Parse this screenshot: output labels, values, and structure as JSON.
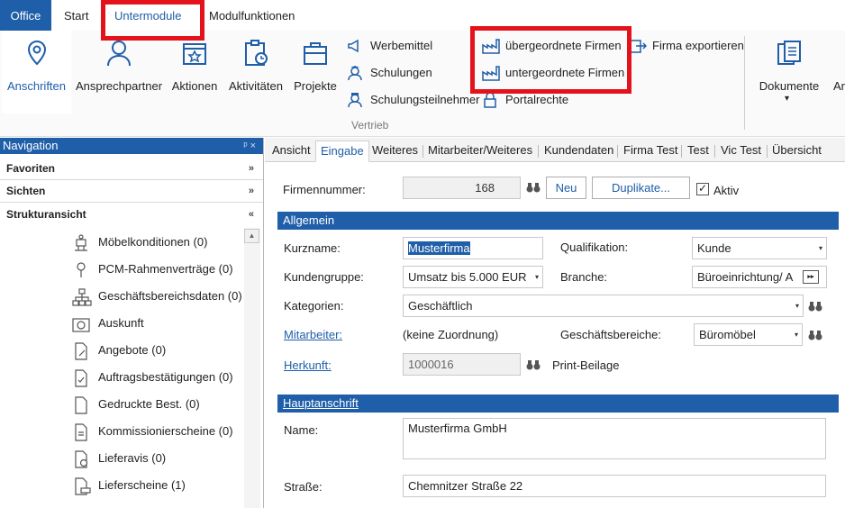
{
  "ribbon_tabs": [
    "Office",
    "Start",
    "Untermodule",
    "Modulfunktionen"
  ],
  "ribbon": {
    "big_buttons": [
      "Anschriften",
      "Ansprechpartner",
      "Aktionen",
      "Aktivitäten",
      "Projekte"
    ],
    "vertrieb_items": [
      "Werbemittel",
      "Schulungen",
      "Schulungsteilnehmer"
    ],
    "firm_items": [
      "übergeordnete Firmen",
      "untergeordnete Firmen"
    ],
    "portalrechte": "Portalrechte",
    "firma_exportieren": "Firma exportieren",
    "group_name": "Vertrieb",
    "dokumente": "Dokumente",
    "cut_label": "An",
    "dokumente_arrow": "▾"
  },
  "navigation": {
    "title": "Navigation",
    "pin": "ᵖ ×",
    "sections": [
      {
        "label": "Favoriten",
        "chevron": "»"
      },
      {
        "label": "Sichten",
        "chevron": "»"
      },
      {
        "label": "Strukturansicht",
        "chevron": "«"
      }
    ],
    "scroll_up": "▲",
    "items": [
      {
        "label": "Möbelkonditionen (0)",
        "icon": "person-stand-icon"
      },
      {
        "label": "PCM-Rahmenverträge (0)",
        "icon": "pin-icon"
      },
      {
        "label": "Geschäftsbereichsdaten (0)",
        "icon": "org-chart-icon"
      },
      {
        "label": "Auskunft",
        "icon": "camera-icon"
      },
      {
        "label": "Angebote (0)",
        "icon": "document-pen-icon"
      },
      {
        "label": "Auftragsbestätigungen (0)",
        "icon": "document-check-icon"
      },
      {
        "label": "Gedruckte Best. (0)",
        "icon": "document-icon"
      },
      {
        "label": "Kommissionierscheine (0)",
        "icon": "document-list-icon"
      },
      {
        "label": "Lieferavis (0)",
        "icon": "document-clock-icon"
      },
      {
        "label": "Lieferscheine (1)",
        "icon": "document-truck-icon"
      }
    ]
  },
  "form_tabs": [
    "Ansicht",
    "Eingabe",
    "Weiteres",
    "Mitarbeiter/Weiteres",
    "Kundendaten",
    "Firma Test",
    "Test",
    "Vic Test",
    "Übersicht"
  ],
  "form": {
    "firmennummer_label": "Firmennummer:",
    "firmennummer_value": "168",
    "neu_button": "Neu",
    "duplikate_button": "Duplikate...",
    "aktiv_label": "Aktiv",
    "aktiv_checked": "✓",
    "dropdown_arrow": "▾",
    "arrow_button": "▸▸",
    "section_allgemein": "Allgemein",
    "kurzname_label": "Kurzname:",
    "kurzname_value": "Musterfirma",
    "qualifikation_label": "Qualifikation:",
    "qualifikation_value": "Kunde",
    "kundengruppe_label": "Kundengruppe:",
    "kundengruppe_value": "Umsatz bis 5.000 EUR",
    "branche_label": "Branche:",
    "branche_value": "Büroeinrichtung/ A",
    "kategorien_label": "Kategorien:",
    "kategorien_value": "Geschäftlich",
    "mitarbeiter_label": "Mitarbeiter:",
    "mitarbeiter_value": "(keine Zuordnung)",
    "geschaeftsbereiche_label": "Geschäftsbereiche:",
    "geschaeftsbereiche_value": "Büromöbel",
    "herkunft_label": "Herkunft:",
    "herkunft_value": "1000016",
    "herkunft_text": "Print-Beilage",
    "section_hauptanschrift": "Hauptanschrift",
    "name_label": "Name:",
    "name_value": "Musterfirma GmbH",
    "strasse_label": "Straße:",
    "strasse_value": "Chemnitzer Straße 22"
  },
  "colors": {
    "accent": "#1f5ea8",
    "highlight": "#e3121b"
  }
}
